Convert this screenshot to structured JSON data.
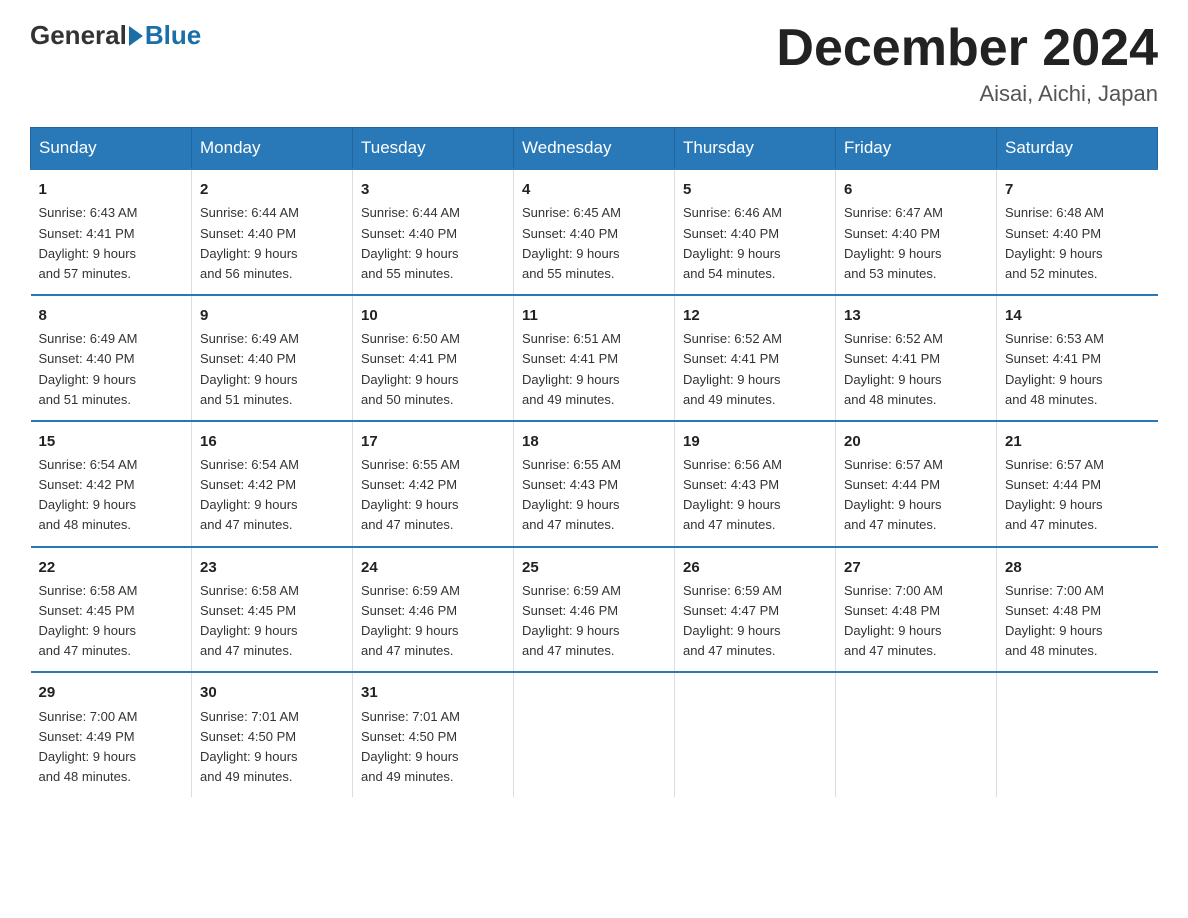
{
  "header": {
    "logo_general": "General",
    "logo_blue": "Blue",
    "title": "December 2024",
    "location": "Aisai, Aichi, Japan"
  },
  "weekdays": [
    "Sunday",
    "Monday",
    "Tuesday",
    "Wednesday",
    "Thursday",
    "Friday",
    "Saturday"
  ],
  "weeks": [
    [
      {
        "day": "1",
        "sunrise": "Sunrise: 6:43 AM",
        "sunset": "Sunset: 4:41 PM",
        "daylight": "Daylight: 9 hours",
        "daylight2": "and 57 minutes."
      },
      {
        "day": "2",
        "sunrise": "Sunrise: 6:44 AM",
        "sunset": "Sunset: 4:40 PM",
        "daylight": "Daylight: 9 hours",
        "daylight2": "and 56 minutes."
      },
      {
        "day": "3",
        "sunrise": "Sunrise: 6:44 AM",
        "sunset": "Sunset: 4:40 PM",
        "daylight": "Daylight: 9 hours",
        "daylight2": "and 55 minutes."
      },
      {
        "day": "4",
        "sunrise": "Sunrise: 6:45 AM",
        "sunset": "Sunset: 4:40 PM",
        "daylight": "Daylight: 9 hours",
        "daylight2": "and 55 minutes."
      },
      {
        "day": "5",
        "sunrise": "Sunrise: 6:46 AM",
        "sunset": "Sunset: 4:40 PM",
        "daylight": "Daylight: 9 hours",
        "daylight2": "and 54 minutes."
      },
      {
        "day": "6",
        "sunrise": "Sunrise: 6:47 AM",
        "sunset": "Sunset: 4:40 PM",
        "daylight": "Daylight: 9 hours",
        "daylight2": "and 53 minutes."
      },
      {
        "day": "7",
        "sunrise": "Sunrise: 6:48 AM",
        "sunset": "Sunset: 4:40 PM",
        "daylight": "Daylight: 9 hours",
        "daylight2": "and 52 minutes."
      }
    ],
    [
      {
        "day": "8",
        "sunrise": "Sunrise: 6:49 AM",
        "sunset": "Sunset: 4:40 PM",
        "daylight": "Daylight: 9 hours",
        "daylight2": "and 51 minutes."
      },
      {
        "day": "9",
        "sunrise": "Sunrise: 6:49 AM",
        "sunset": "Sunset: 4:40 PM",
        "daylight": "Daylight: 9 hours",
        "daylight2": "and 51 minutes."
      },
      {
        "day": "10",
        "sunrise": "Sunrise: 6:50 AM",
        "sunset": "Sunset: 4:41 PM",
        "daylight": "Daylight: 9 hours",
        "daylight2": "and 50 minutes."
      },
      {
        "day": "11",
        "sunrise": "Sunrise: 6:51 AM",
        "sunset": "Sunset: 4:41 PM",
        "daylight": "Daylight: 9 hours",
        "daylight2": "and 49 minutes."
      },
      {
        "day": "12",
        "sunrise": "Sunrise: 6:52 AM",
        "sunset": "Sunset: 4:41 PM",
        "daylight": "Daylight: 9 hours",
        "daylight2": "and 49 minutes."
      },
      {
        "day": "13",
        "sunrise": "Sunrise: 6:52 AM",
        "sunset": "Sunset: 4:41 PM",
        "daylight": "Daylight: 9 hours",
        "daylight2": "and 48 minutes."
      },
      {
        "day": "14",
        "sunrise": "Sunrise: 6:53 AM",
        "sunset": "Sunset: 4:41 PM",
        "daylight": "Daylight: 9 hours",
        "daylight2": "and 48 minutes."
      }
    ],
    [
      {
        "day": "15",
        "sunrise": "Sunrise: 6:54 AM",
        "sunset": "Sunset: 4:42 PM",
        "daylight": "Daylight: 9 hours",
        "daylight2": "and 48 minutes."
      },
      {
        "day": "16",
        "sunrise": "Sunrise: 6:54 AM",
        "sunset": "Sunset: 4:42 PM",
        "daylight": "Daylight: 9 hours",
        "daylight2": "and 47 minutes."
      },
      {
        "day": "17",
        "sunrise": "Sunrise: 6:55 AM",
        "sunset": "Sunset: 4:42 PM",
        "daylight": "Daylight: 9 hours",
        "daylight2": "and 47 minutes."
      },
      {
        "day": "18",
        "sunrise": "Sunrise: 6:55 AM",
        "sunset": "Sunset: 4:43 PM",
        "daylight": "Daylight: 9 hours",
        "daylight2": "and 47 minutes."
      },
      {
        "day": "19",
        "sunrise": "Sunrise: 6:56 AM",
        "sunset": "Sunset: 4:43 PM",
        "daylight": "Daylight: 9 hours",
        "daylight2": "and 47 minutes."
      },
      {
        "day": "20",
        "sunrise": "Sunrise: 6:57 AM",
        "sunset": "Sunset: 4:44 PM",
        "daylight": "Daylight: 9 hours",
        "daylight2": "and 47 minutes."
      },
      {
        "day": "21",
        "sunrise": "Sunrise: 6:57 AM",
        "sunset": "Sunset: 4:44 PM",
        "daylight": "Daylight: 9 hours",
        "daylight2": "and 47 minutes."
      }
    ],
    [
      {
        "day": "22",
        "sunrise": "Sunrise: 6:58 AM",
        "sunset": "Sunset: 4:45 PM",
        "daylight": "Daylight: 9 hours",
        "daylight2": "and 47 minutes."
      },
      {
        "day": "23",
        "sunrise": "Sunrise: 6:58 AM",
        "sunset": "Sunset: 4:45 PM",
        "daylight": "Daylight: 9 hours",
        "daylight2": "and 47 minutes."
      },
      {
        "day": "24",
        "sunrise": "Sunrise: 6:59 AM",
        "sunset": "Sunset: 4:46 PM",
        "daylight": "Daylight: 9 hours",
        "daylight2": "and 47 minutes."
      },
      {
        "day": "25",
        "sunrise": "Sunrise: 6:59 AM",
        "sunset": "Sunset: 4:46 PM",
        "daylight": "Daylight: 9 hours",
        "daylight2": "and 47 minutes."
      },
      {
        "day": "26",
        "sunrise": "Sunrise: 6:59 AM",
        "sunset": "Sunset: 4:47 PM",
        "daylight": "Daylight: 9 hours",
        "daylight2": "and 47 minutes."
      },
      {
        "day": "27",
        "sunrise": "Sunrise: 7:00 AM",
        "sunset": "Sunset: 4:48 PM",
        "daylight": "Daylight: 9 hours",
        "daylight2": "and 47 minutes."
      },
      {
        "day": "28",
        "sunrise": "Sunrise: 7:00 AM",
        "sunset": "Sunset: 4:48 PM",
        "daylight": "Daylight: 9 hours",
        "daylight2": "and 48 minutes."
      }
    ],
    [
      {
        "day": "29",
        "sunrise": "Sunrise: 7:00 AM",
        "sunset": "Sunset: 4:49 PM",
        "daylight": "Daylight: 9 hours",
        "daylight2": "and 48 minutes."
      },
      {
        "day": "30",
        "sunrise": "Sunrise: 7:01 AM",
        "sunset": "Sunset: 4:50 PM",
        "daylight": "Daylight: 9 hours",
        "daylight2": "and 49 minutes."
      },
      {
        "day": "31",
        "sunrise": "Sunrise: 7:01 AM",
        "sunset": "Sunset: 4:50 PM",
        "daylight": "Daylight: 9 hours",
        "daylight2": "and 49 minutes."
      },
      {
        "day": "",
        "sunrise": "",
        "sunset": "",
        "daylight": "",
        "daylight2": ""
      },
      {
        "day": "",
        "sunrise": "",
        "sunset": "",
        "daylight": "",
        "daylight2": ""
      },
      {
        "day": "",
        "sunrise": "",
        "sunset": "",
        "daylight": "",
        "daylight2": ""
      },
      {
        "day": "",
        "sunrise": "",
        "sunset": "",
        "daylight": "",
        "daylight2": ""
      }
    ]
  ]
}
